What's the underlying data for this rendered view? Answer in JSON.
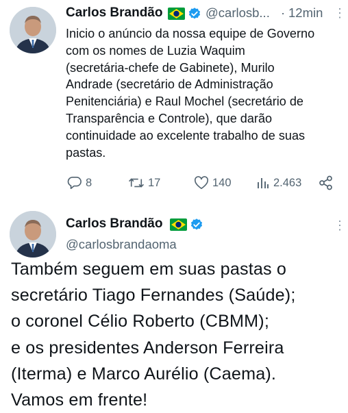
{
  "tweet1": {
    "author_name": "Carlos Brandão",
    "handle": "@carlosb...",
    "separator": "·",
    "time": "12min",
    "text": "Inicio o anúncio da nossa equipe de Governo\ncom os nomes de Luzia Waquim\n(secretária-chefe de Gabinete), Murilo\nAndrade (secretário de Administração\nPenitenciária) e Raul Mochel (secretário de\nTransparência e Controle), que darão\ncontinuidade ao excelente trabalho de suas\npastas.",
    "replies": "8",
    "retweets": "17",
    "likes": "140",
    "views": "2.463"
  },
  "tweet2": {
    "author_name": "Carlos Brandão",
    "handle": "@carlosbrandaoma",
    "text": "Também seguem em suas pastas o\nsecretário Tiago Fernandes (Saúde);\no coronel Célio Roberto (CBMM);\ne os presidentes Anderson Ferreira\n(Iterma) e Marco Aurélio (Caema).\nVamos em frente!"
  },
  "colors": {
    "text": "#0f1419",
    "secondary": "#536471",
    "verified": "#1d9bf0",
    "flag_green": "#009c3b",
    "flag_yellow": "#ffdf00",
    "flag_blue": "#002776"
  },
  "icons": [
    "brazil-flag-icon",
    "verified-badge-icon",
    "more-options-icon",
    "reply-icon",
    "retweet-icon",
    "like-icon",
    "views-icon",
    "share-icon"
  ]
}
